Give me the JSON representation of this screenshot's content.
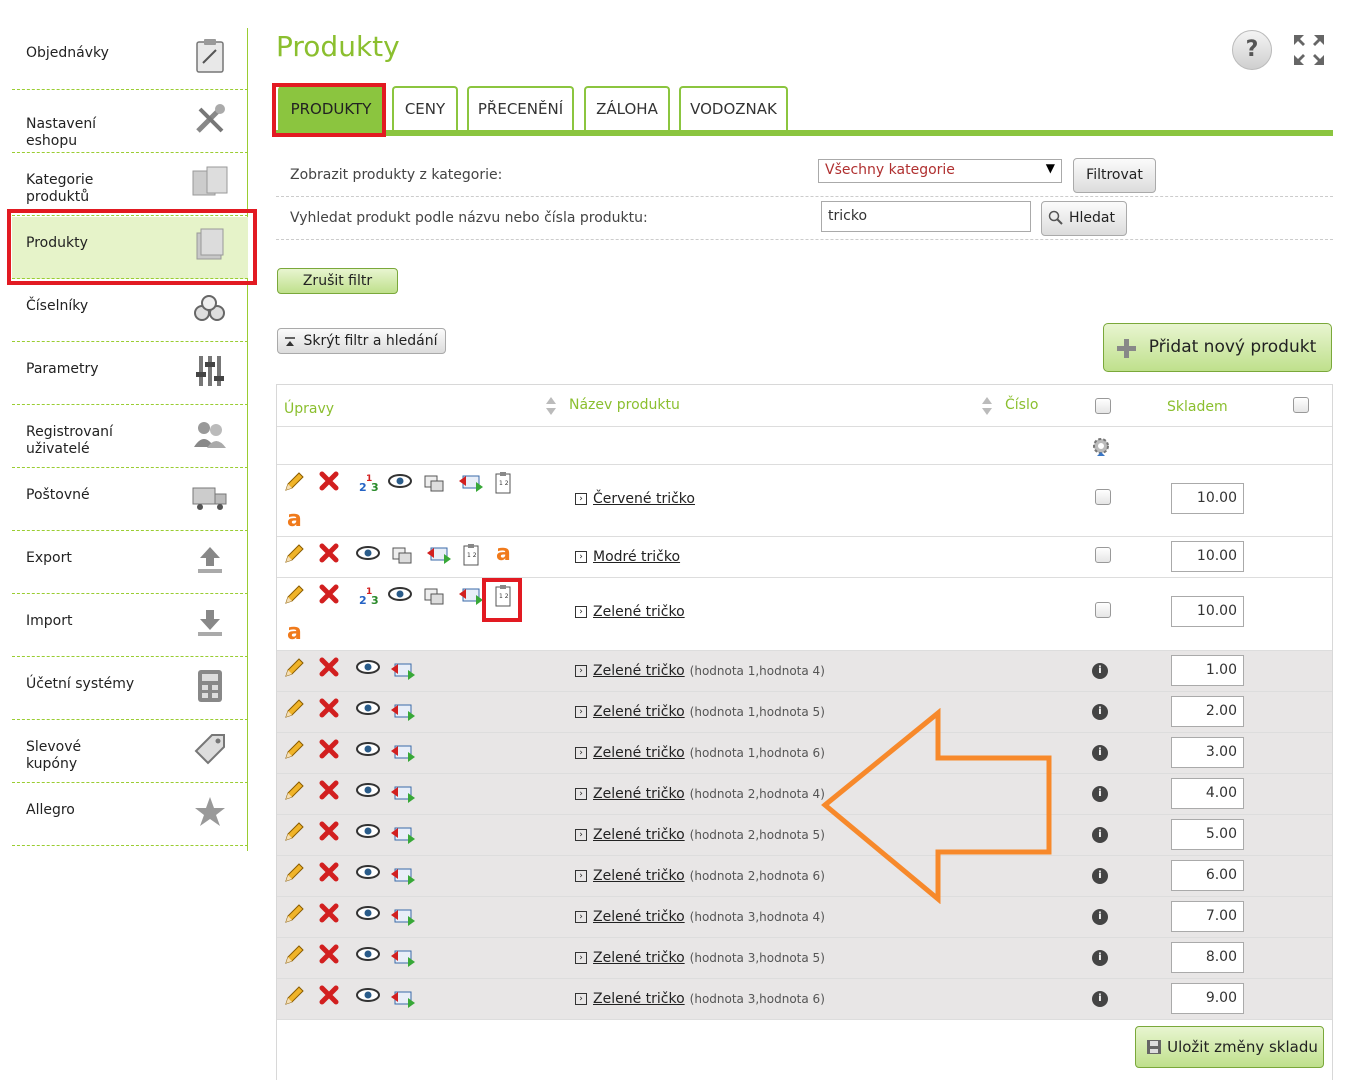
{
  "sidebar": {
    "items": [
      {
        "label": "Objednávky",
        "icon": "orders-icon"
      },
      {
        "label": "Nastavení eshopu",
        "icon": "tools-icon"
      },
      {
        "label": "Kategorie produktů",
        "icon": "categories-icon"
      },
      {
        "label": "Produkty",
        "icon": "products-icon"
      },
      {
        "label": "Číselníky",
        "icon": "codelists-icon"
      },
      {
        "label": "Parametry",
        "icon": "sliders-icon"
      },
      {
        "label": "Registrovaní uživatelé",
        "icon": "users-icon"
      },
      {
        "label": "Poštovné",
        "icon": "shipping-icon"
      },
      {
        "label": "Export",
        "icon": "export-icon"
      },
      {
        "label": "Import",
        "icon": "import-icon"
      },
      {
        "label": "Účetní systémy",
        "icon": "calculator-icon"
      },
      {
        "label": "Slevové kupóny",
        "icon": "coupon-icon"
      },
      {
        "label": "Allegro",
        "icon": "star-icon"
      }
    ]
  },
  "header": {
    "title": "Produkty",
    "help": "?"
  },
  "tabs": [
    {
      "label": "PRODUKTY"
    },
    {
      "label": "CENY"
    },
    {
      "label": "PŘECENĚNÍ"
    },
    {
      "label": "ZÁLOHA"
    },
    {
      "label": "VODOZNAK"
    }
  ],
  "filter": {
    "category_label": "Zobrazit produkty z kategorie:",
    "category_value": "Všechny kategorie",
    "filter_button": "Filtrovat",
    "search_label": "Vyhledat produkt podle názvu nebo čísla produktu:",
    "search_value": "tricko",
    "search_button": "Hledat",
    "clear_button": "Zrušit filtr",
    "hide_button": "Skrýt filtr a hledání"
  },
  "add_button": "Přidat nový produkt",
  "table": {
    "columns": [
      "Úpravy",
      "Název produktu",
      "Číslo",
      "Skladem"
    ],
    "rows": [
      {
        "name": "Červené tričko",
        "extra": "",
        "stock": "10.00"
      },
      {
        "name": "Modré tričko",
        "extra": "",
        "stock": "10.00"
      },
      {
        "name": "Zelené tričko",
        "extra": "",
        "stock": "10.00"
      },
      {
        "name": "Zelené tričko",
        "extra": "(hodnota 1,hodnota 4)",
        "stock": "1.00"
      },
      {
        "name": "Zelené tričko",
        "extra": "(hodnota 1,hodnota 5)",
        "stock": "2.00"
      },
      {
        "name": "Zelené tričko",
        "extra": "(hodnota 1,hodnota 6)",
        "stock": "3.00"
      },
      {
        "name": "Zelené tričko",
        "extra": "(hodnota 2,hodnota 4)",
        "stock": "4.00"
      },
      {
        "name": "Zelené tričko",
        "extra": "(hodnota 2,hodnota 5)",
        "stock": "5.00"
      },
      {
        "name": "Zelené tričko",
        "extra": "(hodnota 2,hodnota 6)",
        "stock": "6.00"
      },
      {
        "name": "Zelené tričko",
        "extra": "(hodnota 3,hodnota 4)",
        "stock": "7.00"
      },
      {
        "name": "Zelené tričko",
        "extra": "(hodnota 3,hodnota 5)",
        "stock": "8.00"
      },
      {
        "name": "Zelené tričko",
        "extra": "(hodnota 3,hodnota 6)",
        "stock": "9.00"
      }
    ],
    "save_button": "Uložit změny skladu"
  },
  "colors": {
    "accent": "#8bc53f",
    "highlight": "#e21a22",
    "arrow": "#f7892b"
  }
}
